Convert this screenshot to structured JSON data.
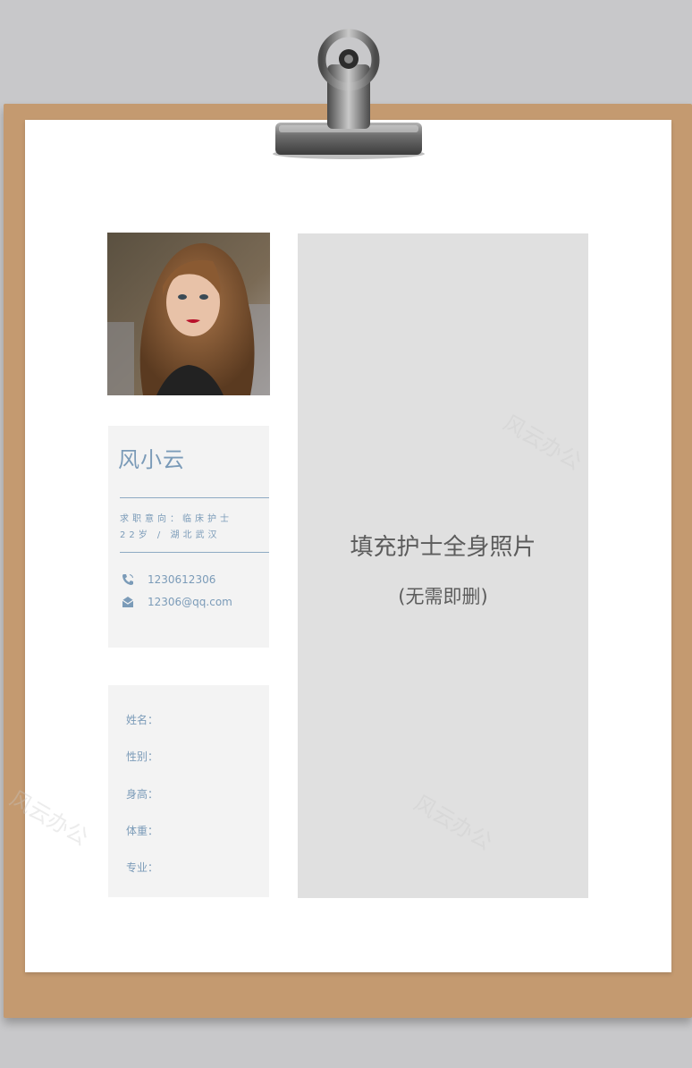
{
  "profile": {
    "name": "风小云",
    "objective": "求职意向：临床护士",
    "age_location": "22岁 / 湖北武汉",
    "phone": "1230612306",
    "email": "12306@qq.com"
  },
  "fields": [
    {
      "label": "姓名："
    },
    {
      "label": "性别："
    },
    {
      "label": "身高："
    },
    {
      "label": "体重："
    },
    {
      "label": "专业："
    }
  ],
  "placeholder": {
    "title": "填充护士全身照片",
    "subtitle": "(无需即删)"
  },
  "watermark": "风云办公",
  "colors": {
    "accent": "#7b9bb8",
    "board": "#c49a70",
    "card": "#f3f3f3",
    "placeholder": "#e0e0e0"
  },
  "icons": [
    "phone-icon",
    "mail-icon"
  ]
}
